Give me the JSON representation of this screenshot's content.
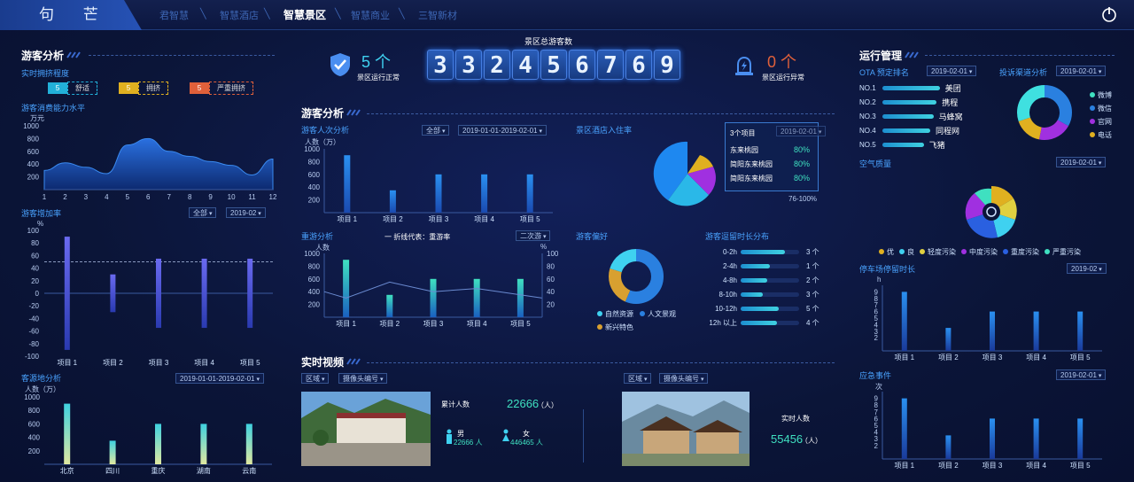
{
  "header": {
    "logo": "句 芒",
    "nav": [
      "君智慧",
      "智慧酒店",
      "智慧景区",
      "智慧商业",
      "三智新材"
    ],
    "active_index": 2,
    "separators": [
      "╲",
      "╲",
      "╲",
      "╲"
    ]
  },
  "center_top": {
    "title": "景区总游客数",
    "digits": [
      "3",
      "3",
      "2",
      "4",
      "5",
      "6",
      "7",
      "6",
      "9"
    ],
    "normal_value": "5 个",
    "normal_label": "景区运行正常",
    "abnormal_value": "0 个",
    "abnormal_label": "景区运行异常"
  },
  "left": {
    "title": "游客分析",
    "crowd_title": "实时拥挤程度",
    "crowd_legend": [
      {
        "num": "5",
        "label": "舒适",
        "color": "#22b0d8"
      },
      {
        "num": "5",
        "label": "拥挤",
        "color": "#e0b020"
      },
      {
        "num": "5",
        "label": "严重拥挤",
        "color": "#e0603a"
      }
    ],
    "consume_title": "游客消费能力水平",
    "consume_unit": "万元",
    "growth_title": "游客增加率",
    "growth_sel1": "全部",
    "growth_sel2": "2019-02",
    "growth_unit": "%",
    "source_title": "客源地分析",
    "source_sel": "2019-01-01-2019-02-01",
    "source_unit": "人数（万）"
  },
  "middle": {
    "title": "游客分析",
    "count_title": "游客人次分析",
    "count_sel1": "全部",
    "count_sel2": "2019-01-01-2019-02-01",
    "count_unit": "人数（万）",
    "hotel_title": "景区酒店入住率",
    "hotel_popup_title": "3个项目",
    "hotel_popup_sel": "2019-02-01",
    "hotel_rows": [
      {
        "name": "东来桃园",
        "value": "80%"
      },
      {
        "name": "简阳东来桃园",
        "value": "80%"
      },
      {
        "name": "简阳东来桃园",
        "value": "80%"
      }
    ],
    "hotel_legend_tail": "76-100%",
    "revisit_title": "重游分析",
    "revisit_legend": "一 折线代表：重游率",
    "revisit_sel": "二次游",
    "revisit_unit_left": "人数",
    "revisit_unit_right": "%",
    "pref_title": "游客偏好",
    "pref_legend": [
      {
        "label": "自然资源",
        "color": "#3fd1f0"
      },
      {
        "label": "人文景观",
        "color": "#2a80e0"
      },
      {
        "label": "新兴特色",
        "color": "#d8a030"
      }
    ],
    "stay_title": "游客逗留时长分布",
    "stay_rows": [
      {
        "label": "0-2h",
        "value": "3 个",
        "frac": 0.75
      },
      {
        "label": "2-4h",
        "value": "1 个",
        "frac": 0.5
      },
      {
        "label": "4-8h",
        "value": "2 个",
        "frac": 0.45
      },
      {
        "label": "8-10h",
        "value": "3 个",
        "frac": 0.38
      },
      {
        "label": "10-12h",
        "value": "5 个",
        "frac": 0.65
      },
      {
        "label": "12h 以上",
        "value": "4 个",
        "frac": 0.62
      }
    ],
    "video_title": "实时视频",
    "video_sel_area": "区域",
    "video_sel_cam": "摄像头编号",
    "video_total_label": "累计人数",
    "video_total_value": "22666",
    "video_total_unit": "（人）",
    "video_male_label": "男",
    "video_male_value": "22666 人",
    "video_female_label": "女",
    "video_female_value": "446465 人",
    "video2_sel_area": "区域",
    "video2_sel_cam": "摄像头编号",
    "video2_label": "实时人数",
    "video2_value": "55456",
    "video2_unit": "（人）"
  },
  "right": {
    "title": "运行管理",
    "ota_title": "OTA 预定排名",
    "ota_sel": "2019-02-01",
    "ota_rows": [
      {
        "rank": "NO.1",
        "name": "美团",
        "frac": 0.9
      },
      {
        "rank": "NO.2",
        "name": "携程",
        "frac": 0.85
      },
      {
        "rank": "NO.3",
        "name": "马蜂窝",
        "frac": 0.8
      },
      {
        "rank": "NO.4",
        "name": "同程网",
        "frac": 0.75
      },
      {
        "rank": "NO.5",
        "name": "飞猪",
        "frac": 0.65
      }
    ],
    "complaint_title": "投诉渠道分析",
    "complaint_sel": "2019-02-01",
    "complaint_legend": [
      {
        "label": "微博",
        "color": "#3fe0c0"
      },
      {
        "label": "微信",
        "color": "#2a80e0"
      },
      {
        "label": "官网",
        "color": "#a030e0"
      },
      {
        "label": "电话",
        "color": "#e0b020"
      }
    ],
    "air_title": "空气质量",
    "air_sel": "2019-02-01",
    "air_legend": [
      {
        "label": "优",
        "color": "#e0b020"
      },
      {
        "label": "良",
        "color": "#3fd1f0"
      },
      {
        "label": "轻度污染",
        "color": "#e0d040"
      },
      {
        "label": "中度污染",
        "color": "#a030e0"
      },
      {
        "label": "重度污染",
        "color": "#2a60e0"
      },
      {
        "label": "严重污染",
        "color": "#3fe0c0"
      }
    ],
    "park_title": "停车场停留时长",
    "park_sel": "2019-02",
    "park_unit": "h",
    "emerg_title": "应急事件",
    "emerg_sel": "2019-02-01",
    "emerg_unit": "次"
  },
  "chart_data": [
    {
      "type": "area",
      "title": "游客消费能力水平",
      "ylabel": "万元",
      "x": [
        1,
        2,
        3,
        4,
        5,
        6,
        7,
        8,
        9,
        10,
        11,
        12
      ],
      "values": [
        300,
        420,
        350,
        250,
        700,
        800,
        600,
        520,
        440,
        380,
        230,
        480
      ],
      "ylim": [
        0,
        1000
      ],
      "yticks": [
        200,
        400,
        600,
        800,
        1000
      ]
    },
    {
      "type": "bar",
      "title": "游客增加率",
      "ylabel": "%",
      "categories": [
        "项目 1",
        "项目 2",
        "项目 3",
        "项目 4",
        "项目 5"
      ],
      "values": [
        {
          "pos": 90,
          "neg": -90
        },
        {
          "pos": 30,
          "neg": -30
        },
        {
          "pos": 55,
          "neg": -55
        },
        {
          "pos": 55,
          "neg": -55
        },
        {
          "pos": 55,
          "neg": -55
        }
      ],
      "ylim": [
        -100,
        100
      ],
      "yticks": [
        100,
        80,
        60,
        40,
        20,
        0,
        -20,
        -40,
        -60,
        -80,
        -100
      ],
      "reference": 50
    },
    {
      "type": "bar",
      "title": "客源地分析",
      "ylabel": "人数（万）",
      "categories": [
        "北京",
        "四川",
        "重庆",
        "湖南",
        "云南"
      ],
      "values": [
        900,
        350,
        600,
        600,
        600
      ],
      "ylim": [
        0,
        1000
      ],
      "yticks": [
        200,
        400,
        600,
        800,
        1000
      ]
    },
    {
      "type": "bar",
      "title": "游客人次分析",
      "ylabel": "人数（万）",
      "categories": [
        "项目 1",
        "项目 2",
        "项目 3",
        "项目 4",
        "项目 5"
      ],
      "values": [
        900,
        350,
        600,
        600,
        600
      ],
      "ylim": [
        0,
        1000
      ],
      "yticks": [
        200,
        400,
        600,
        800,
        1000
      ]
    },
    {
      "type": "bar+line",
      "title": "重游分析",
      "categories": [
        "项目 1",
        "项目 2",
        "项目 3",
        "项目 4",
        "项目 5"
      ],
      "values": [
        900,
        350,
        600,
        600,
        600
      ],
      "line": [
        30,
        55,
        40,
        45,
        35
      ],
      "ylim": [
        0,
        1000
      ],
      "y2lim": [
        0,
        100
      ],
      "yticks": [
        200,
        400,
        600,
        800,
        1000
      ],
      "y2ticks": [
        20,
        40,
        60,
        80,
        100
      ]
    },
    {
      "type": "bar",
      "title": "停车场停留时长",
      "ylabel": "h",
      "categories": [
        "项目 1",
        "项目 2",
        "项目 3",
        "项目 4",
        "项目 5"
      ],
      "values": [
        9,
        3.5,
        6,
        6,
        6
      ],
      "ylim": [
        0,
        10
      ],
      "yticks": [
        2,
        3,
        4,
        5,
        6,
        7,
        8,
        9
      ]
    },
    {
      "type": "bar",
      "title": "应急事件",
      "ylabel": "次",
      "categories": [
        "项目 1",
        "项目 2",
        "项目 3",
        "项目 4",
        "项目 5"
      ],
      "values": [
        9,
        3.5,
        6,
        6,
        6
      ],
      "ylim": [
        0,
        10
      ],
      "yticks": [
        2,
        3,
        4,
        5,
        6,
        7,
        8,
        9
      ]
    }
  ]
}
